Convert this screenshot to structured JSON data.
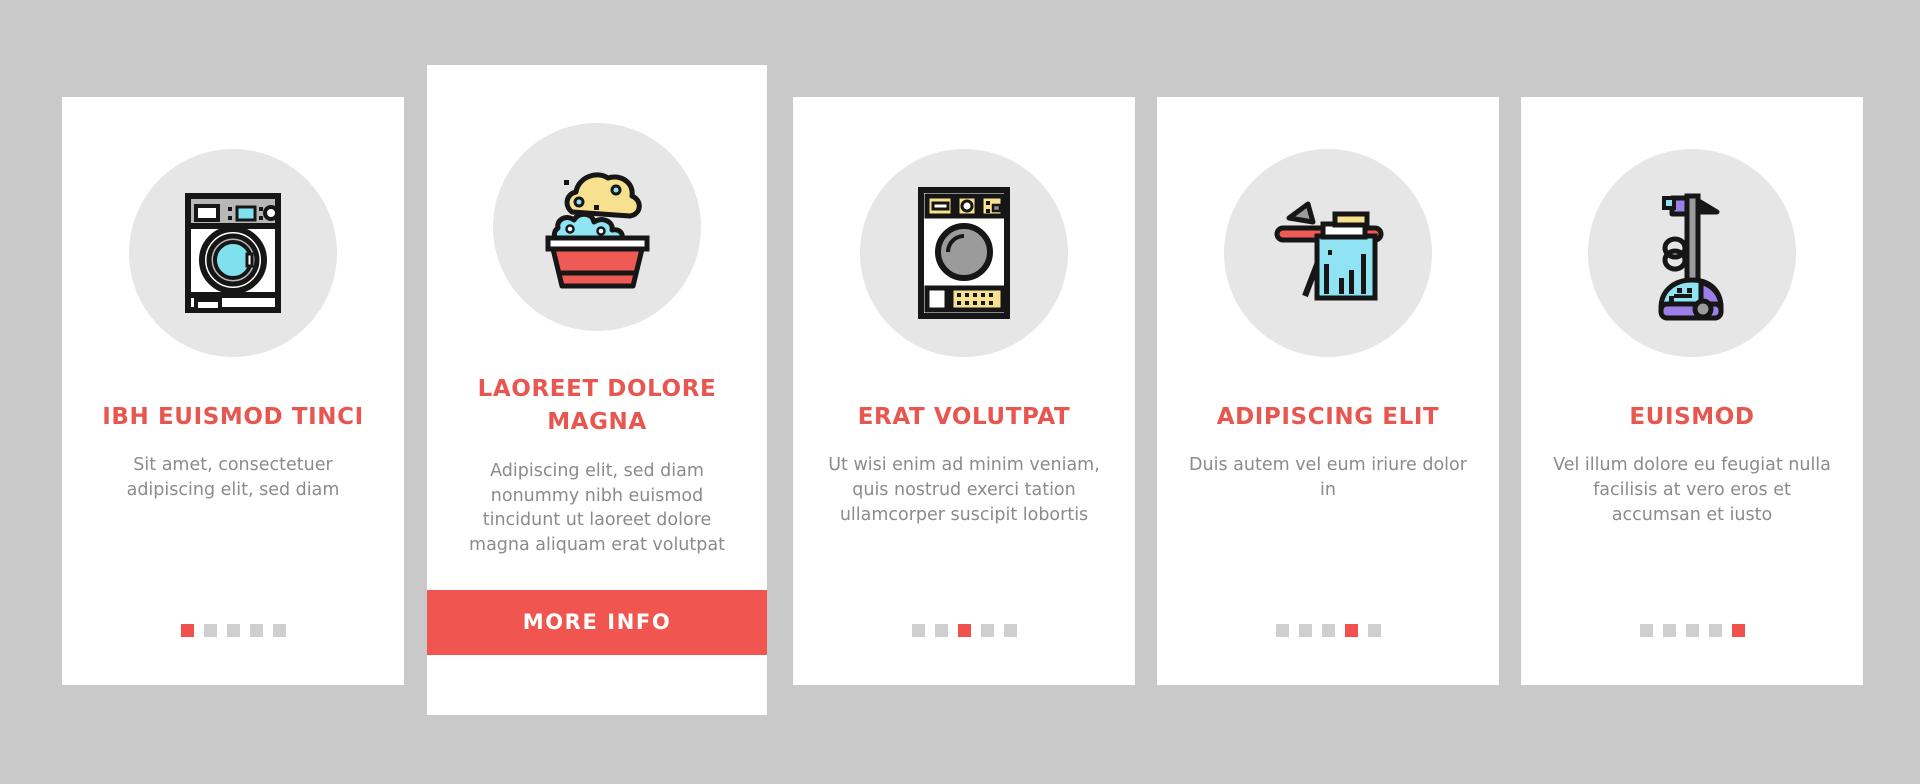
{
  "page": {
    "background_color": "#c9c9c9",
    "card_background": "#ffffff",
    "accent_color": "#e7564f",
    "button_color": "#f0564f",
    "body_text_color": "#8b8b8b",
    "bubble_color": "#e6e6e6",
    "dot_inactive_color": "#cfcfcf"
  },
  "cards": [
    {
      "icon_name": "washing-machine-icon",
      "title": "IBH EUISMOD TINCI",
      "body": "Sit amet, consectetuer adipiscing elit, sed diam",
      "dots_total": 5,
      "dot_active_index": 0,
      "has_cta": false
    },
    {
      "icon_name": "laundry-basin-suds-icon",
      "title": "LAOREET DOLORE MAGNA",
      "body": "Adipiscing elit, sed diam nonummy nibh euismod tincidunt ut laoreet dolore magna aliquam erat volutpat",
      "dots_total": 0,
      "dot_active_index": null,
      "has_cta": true,
      "cta_label": "MORE INFO"
    },
    {
      "icon_name": "laundry-dryer-icon",
      "title": "ERAT VOLUTPAT",
      "body": "Ut wisi enim ad minim veniam, quis nostrud exerci tation ullamcorper suscipit lobortis",
      "dots_total": 5,
      "dot_active_index": 2,
      "has_cta": false
    },
    {
      "icon_name": "ironing-board-icon",
      "title": "ADIPISCING ELIT",
      "body": "Duis autem vel eum iriure dolor in",
      "dots_total": 5,
      "dot_active_index": 3,
      "has_cta": false
    },
    {
      "icon_name": "vacuum-cleaner-icon",
      "title": "EUISMOD",
      "body": "Vel illum dolore eu feugiat nulla facilisis at vero eros et accumsan et iusto",
      "dots_total": 5,
      "dot_active_index": 4,
      "has_cta": false
    }
  ]
}
